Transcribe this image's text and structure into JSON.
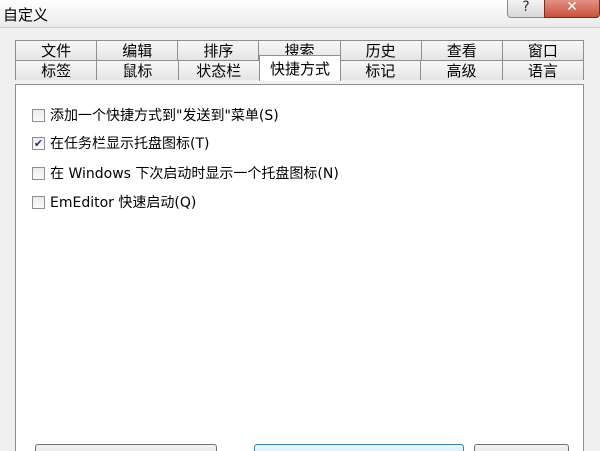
{
  "window": {
    "title": "自定义"
  },
  "tabs": {
    "row1": [
      "文件",
      "编辑",
      "排序",
      "搜索",
      "历史",
      "查看",
      "窗口"
    ],
    "row2": [
      "标签",
      "鼠标",
      "状态栏",
      "快捷方式",
      "标记",
      "高级",
      "语言"
    ],
    "active": "快捷方式"
  },
  "options": [
    {
      "label": "添加一个快捷方式到\"发送到\"菜单(S)",
      "checked": false
    },
    {
      "label": "在任务栏显示托盘图标(T)",
      "checked": true
    },
    {
      "label": "在 Windows 下次启动时显示一个托盘图标(N)",
      "checked": false
    },
    {
      "label": "EmEditor 快速启动(Q)",
      "checked": false
    }
  ],
  "checkmark": "✔",
  "window_buttons": {
    "help": "?",
    "close": "✕"
  }
}
